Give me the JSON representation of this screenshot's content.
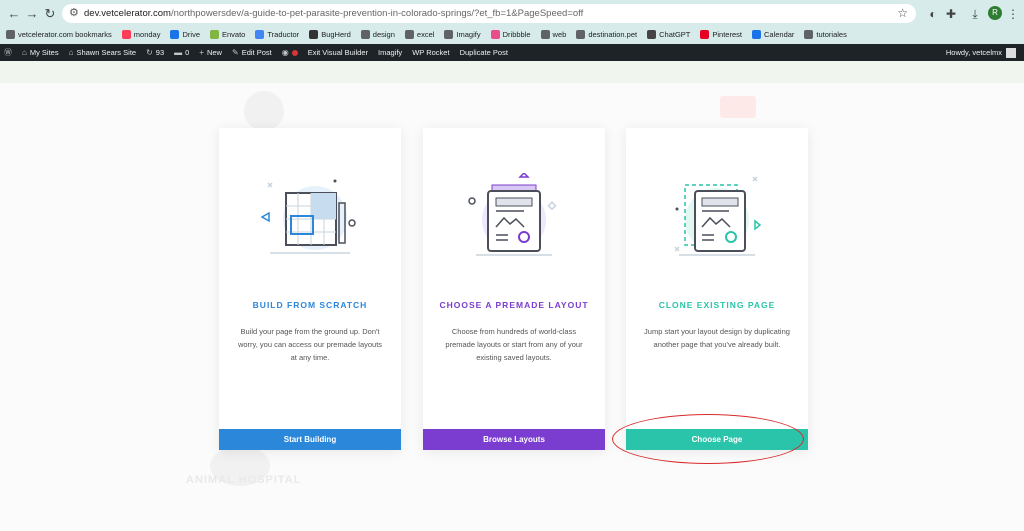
{
  "browser": {
    "url_host": "dev.vetcelerator.com",
    "url_path": "/northpowersdev/a-guide-to-pet-parasite-prevention-in-colorado-springs/?et_fb=1&PageSpeed=off",
    "profile_initial": "R"
  },
  "bookmarks": [
    {
      "label": "vetcelerator.com bookmarks",
      "color": "#5f6368"
    },
    {
      "label": "monday",
      "color": "#ff3d57"
    },
    {
      "label": "Drive",
      "color": "#1a73e8"
    },
    {
      "label": "Envato",
      "color": "#82b541"
    },
    {
      "label": "Traductor",
      "color": "#4285f4"
    },
    {
      "label": "BugHerd",
      "color": "#333333"
    },
    {
      "label": "design",
      "color": "#5f6368"
    },
    {
      "label": "excel",
      "color": "#5f6368"
    },
    {
      "label": "Imagify",
      "color": "#5f6368"
    },
    {
      "label": "Dribbble",
      "color": "#ea4c89"
    },
    {
      "label": "web",
      "color": "#5f6368"
    },
    {
      "label": "destination.pet",
      "color": "#5f6368"
    },
    {
      "label": "ChatGPT",
      "color": "#444444"
    },
    {
      "label": "Pinterest",
      "color": "#e60023"
    },
    {
      "label": "Calendar",
      "color": "#1a73e8"
    },
    {
      "label": "tutoriales",
      "color": "#5f6368"
    }
  ],
  "wpbar": {
    "my_sites": "My Sites",
    "site_name": "Shawn Sears Site",
    "updates_count": "93",
    "comments_count": "0",
    "new": "New",
    "edit_post": "Edit Post",
    "exit_builder": "Exit Visual Builder",
    "imagify": "Imagify",
    "wp_rocket": "WP Rocket",
    "duplicate_post": "Duplicate Post",
    "howdy": "Howdy, vetcelmx"
  },
  "cards": [
    {
      "title": "BUILD FROM SCRATCH",
      "desc": "Build your page from the ground up. Don't worry, you can access our premade layouts at any time.",
      "button": "Start Building",
      "accent": "#2b87da"
    },
    {
      "title": "CHOOSE A PREMADE LAYOUT",
      "desc": "Choose from hundreds of world-class premade layouts or start from any of your existing saved layouts.",
      "button": "Browse Layouts",
      "accent": "#7b3dcf"
    },
    {
      "title": "CLONE EXISTING PAGE",
      "desc": "Jump start your layout design by duplicating another page that you've already built.",
      "button": "Choose Page",
      "accent": "#29c4a9"
    }
  ],
  "background": {
    "faded_text": "ANIMAL HOSPITAL"
  }
}
